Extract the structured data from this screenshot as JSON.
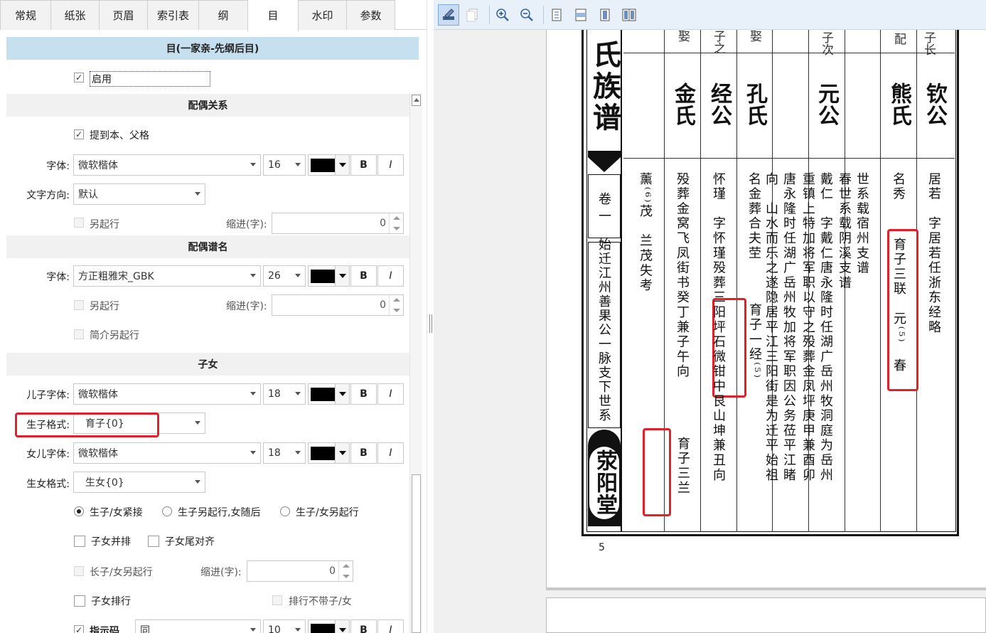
{
  "tabs": [
    "常规",
    "纸张",
    "页眉",
    "索引表",
    "纲",
    "目",
    "水印",
    "参数"
  ],
  "active_tab": "目",
  "section_title": "目(一家亲-先纲后目)",
  "enable": {
    "label": "启用",
    "checked": true
  },
  "spouse_relation": {
    "header": "配偶关系",
    "mention_label": "提到本、父格",
    "font_label": "字体:",
    "font_value": "微软楷体",
    "size_value": "16",
    "direction_label": "文字方向:",
    "direction_value": "默认",
    "newline_label": "另起行",
    "indent_label": "缩进(字):",
    "indent_value": "0"
  },
  "spouse_name": {
    "header": "配偶谱名",
    "font_label": "字体:",
    "font_value": "方正粗雅宋_GBK",
    "size_value": "26",
    "newline_label": "另起行",
    "indent_label": "缩进(字):",
    "indent_value": "0",
    "intro_newline_label": "简介另起行"
  },
  "children": {
    "header": "子女",
    "son_font_label": "儿子字体:",
    "son_font_value": "微软楷体",
    "son_size_value": "18",
    "son_format_label": "生子格式:",
    "son_format_value": "育子{0}",
    "daughter_font_label": "女儿字体:",
    "daughter_font_value": "微软楷体",
    "daughter_size_value": "18",
    "daughter_format_label": "生女格式:",
    "daughter_format_value": "生女{0}",
    "radio_options": [
      "生子/女紧接",
      "生子另起行,女随后",
      "生子/女另起行"
    ],
    "parallel_label": "子女并排",
    "tail_align_label": "子女尾对齐",
    "eldest_newline_label": "长子/女另起行",
    "indent_label": "缩进(字):",
    "indent_value": "0",
    "ranking_label": "子女排行",
    "ranking_no_label": "排行不带子/女",
    "indicator_label": "指示码",
    "indicator_font_value": "同",
    "indicator_size_value": "10"
  },
  "format_buttons": {
    "bold": "B",
    "italic": "I"
  },
  "toolbar_icons": [
    "edit-icon",
    "copy-icon",
    "zoom-in-icon",
    "zoom-out-icon",
    "fit-page-icon",
    "fit-width-icon",
    "single-page-icon",
    "two-page-icon"
  ],
  "preview": {
    "book_title": "氏族谱",
    "volume": "卷一",
    "branch_line": "始迁江州善果公一脉支下世系",
    "hall_name": "荥阳堂",
    "page_number": "5",
    "columns": [
      {
        "rel": "子长",
        "name": "钦公",
        "text": "居若　字居若任浙东经略"
      },
      {
        "rel": "配",
        "name": "熊氏",
        "text": "名秀",
        "highlight": "育子三联　元⁽⁵⁾　春"
      },
      {
        "rel": "",
        "name": "",
        "text": "世系载宿州支谱"
      },
      {
        "rel": "",
        "name": "",
        "text": "春世系载阴溪支谱"
      },
      {
        "rel": "子次",
        "name": "元公",
        "text": "戴仁　字戴仁唐永隆时任湖广岳州牧洞庭为岳州"
      },
      {
        "rel": "",
        "name": "",
        "text": "重镇上特加将军职以守之殁葬金凤坪庚甲兼酉卯"
      },
      {
        "rel": "",
        "name": "",
        "text": "唐永隆时任湖广岳州牧加将军职因公务莅平江睹"
      },
      {
        "rel": "",
        "name": "",
        "text": "向　山水而乐之遂隐居平江三阳街是为迁平始祖"
      },
      {
        "rel": "娶",
        "name": "孔氏",
        "text": "名金葬合夫茔",
        "highlight": "育子一经⁽⁵⁾"
      },
      {
        "rel": "子之",
        "name": "经公",
        "text": "怀瑾　字怀瑾殁葬三阳坪石微钳中艮山坤兼丑向"
      },
      {
        "rel": "娶",
        "name": "金氏",
        "text": "殁葬金窝飞凤街书癸丁兼子午向",
        "highlight": "育子三兰"
      },
      {
        "rel": "",
        "name": "",
        "text": "薰⁽⁶⁾茂　兰茂失考"
      }
    ]
  }
}
